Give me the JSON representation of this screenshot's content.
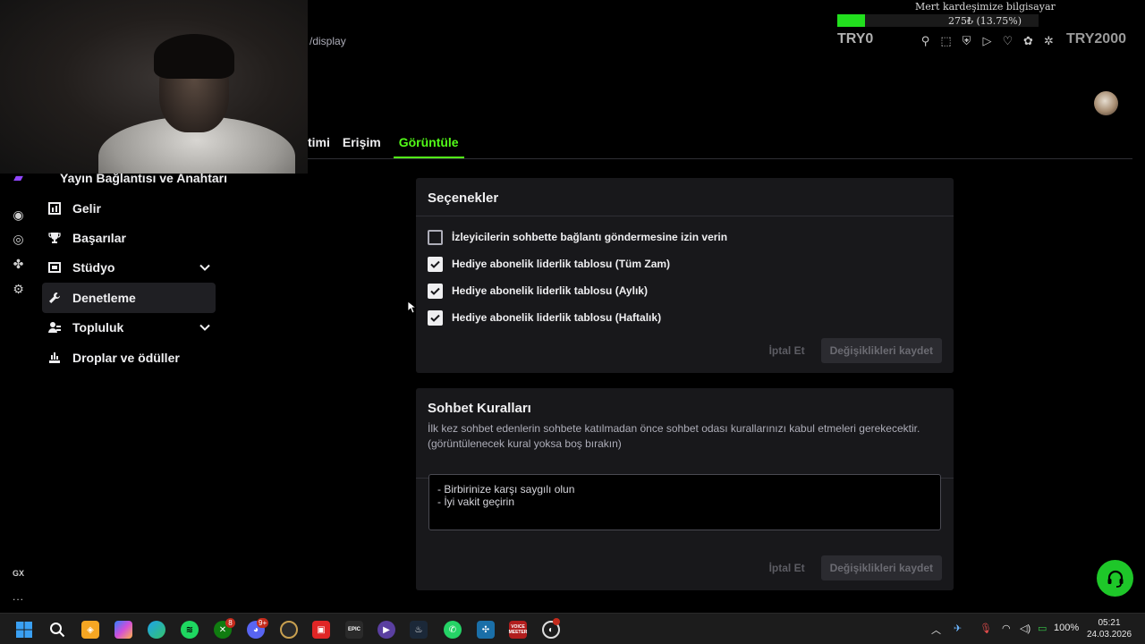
{
  "url_fragment": "/display",
  "overlay": {
    "title": "Mert kardeşimize bilgisayar",
    "amount": "275₺ (13.75%)",
    "progress_fraction": 0.1375,
    "left_label": "TRY0",
    "right_label": "TRY2000",
    "accent": "#22e01e"
  },
  "tabs": [
    {
      "label": "timi"
    },
    {
      "label": "Erişim"
    },
    {
      "label": "Görüntüle"
    }
  ],
  "sidebar": {
    "top_item": "Yayın Bağlantısı ve Anahtarı",
    "items": [
      {
        "label": "Gelir",
        "icon": "bar-chart-icon"
      },
      {
        "label": "Başarılar",
        "icon": "trophy-icon"
      },
      {
        "label": "Stüdyo",
        "icon": "studio-icon",
        "expandable": true
      },
      {
        "label": "Denetleme",
        "icon": "wrench-icon",
        "active": true
      },
      {
        "label": "Topluluk",
        "icon": "community-icon",
        "expandable": true
      },
      {
        "label": "Droplar ve ödüller",
        "icon": "drops-icon"
      }
    ]
  },
  "options_card": {
    "title": "Seçenekler",
    "options": [
      {
        "label": "İzleyicilerin sohbette bağlantı göndermesine izin verin",
        "checked": false
      },
      {
        "label": "Hediye abonelik liderlik tablosu (Tüm Zam)",
        "checked": true
      },
      {
        "label": "Hediye abonelik liderlik tablosu (Aylık)",
        "checked": true
      },
      {
        "label": "Hediye abonelik liderlik tablosu (Haftalık)",
        "checked": true
      }
    ],
    "cancel_label": "İptal Et",
    "save_label": "Değişiklikleri kaydet"
  },
  "rules_card": {
    "title": "Sohbet Kuralları",
    "description": "İlk kez sohbet edenlerin sohbete katılmadan önce sohbet odası kurallarınızı kabul etmeleri gerekecektir. (görüntülenecek kural yoksa boş bırakın)",
    "rules_text": "- Birbirinize karşı saygılı olun\n- İyi vakit geçirin",
    "cancel_label": "İptal Et",
    "save_label": "Değişiklikleri kaydet"
  },
  "rail": {
    "gx_label": "GX",
    "more_label": "..."
  },
  "taskbar": {
    "badge_xbox": "8",
    "badge_discord": "9+",
    "voicemeeter_label": "VOICE MEETER",
    "epic_label": "EPIC",
    "battery": "100%",
    "time": "05:21",
    "date": "24.03.2026"
  }
}
